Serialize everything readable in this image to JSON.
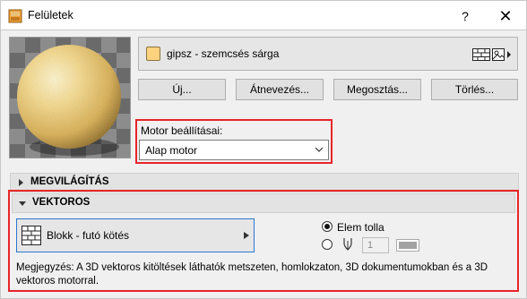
{
  "window": {
    "title": "Felületek",
    "help_label": "?",
    "close_label": "✕"
  },
  "material": {
    "name": "gipsz - szemcsés sárga",
    "swatch_color": "#fcd27f"
  },
  "buttons": {
    "new": "Új...",
    "rename": "Átnevezés...",
    "share": "Megosztás...",
    "delete": "Törlés..."
  },
  "engine": {
    "label": "Motor beállításai:",
    "selected": "Alap motor"
  },
  "sections": {
    "lighting": "MEGVILÁGÍTÁS",
    "vectorial": "VEKTOROS"
  },
  "vectorial": {
    "fill_name": "Blokk - futó kötés",
    "radio_element_pen": "Elem tolla",
    "pen_number": "1",
    "note": "Megjegyzés: A 3D vektoros kitöltések láthatók metszeten, homlokzaton, 3D dokumentumokban és a 3D vektoros motorral."
  },
  "colors": {
    "highlight_red": "#e8242a",
    "focus_blue": "#2b77d0"
  },
  "icons": {
    "app": "surfaces-app-icon",
    "pattern": "brick-pattern-icon",
    "pen": "pen-icon"
  }
}
